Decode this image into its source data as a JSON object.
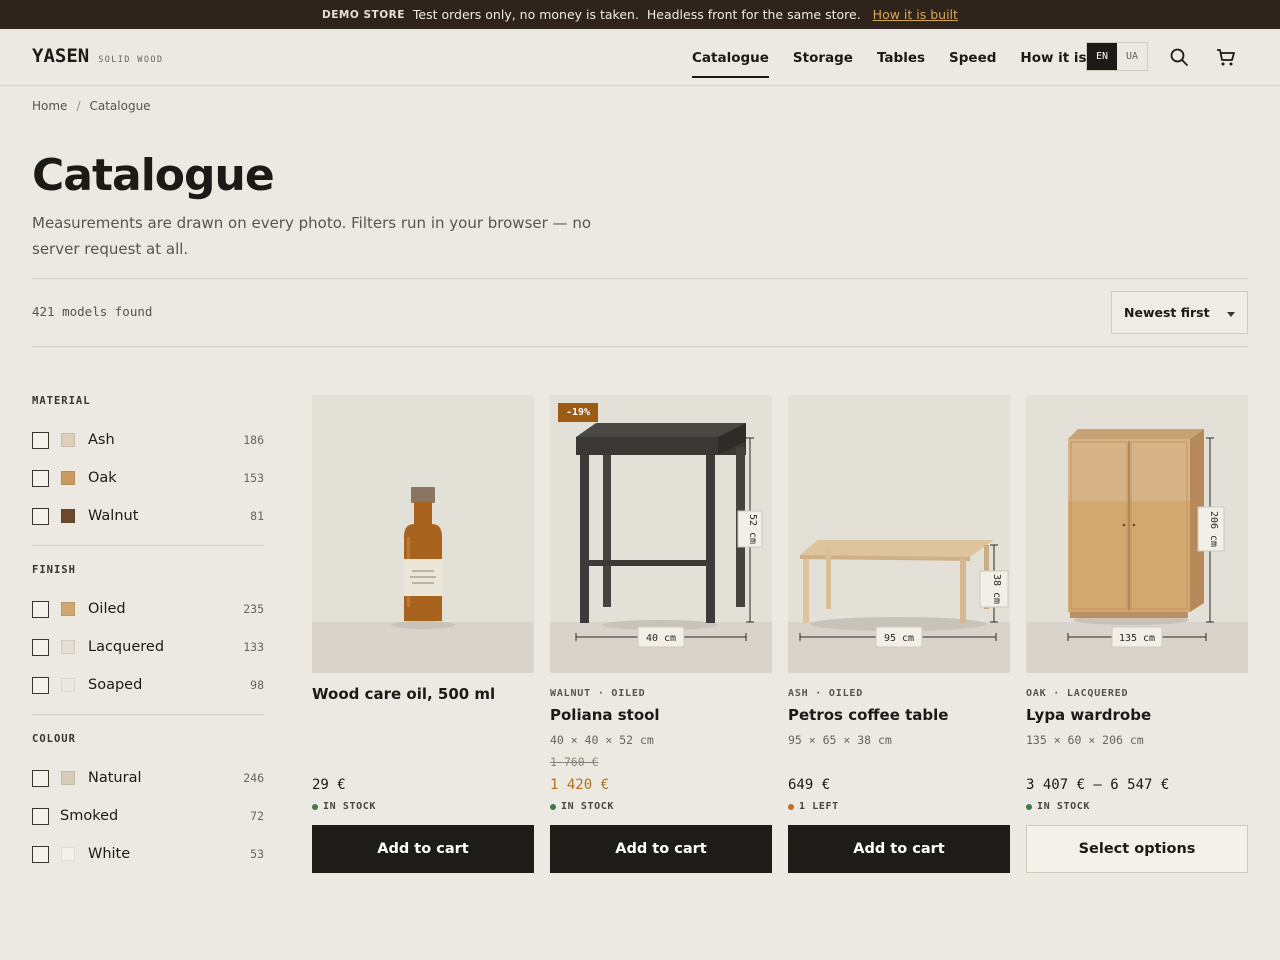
{
  "banner": {
    "tag": "DEMO STORE",
    "text": "Test orders only, no money is taken.  Headless front for the same store.",
    "link": "How it is built"
  },
  "header": {
    "brand": "YASEN",
    "tagline": "SOLID WOOD",
    "nav": [
      "Catalogue",
      "Storage",
      "Tables",
      "Speed",
      "How it is built"
    ],
    "active_nav": "Catalogue",
    "lang": [
      "EN",
      "UA"
    ],
    "active_lang": "EN",
    "icons": [
      "search-icon",
      "cart-icon"
    ]
  },
  "breadcrumb": [
    "Home",
    "Catalogue"
  ],
  "page": {
    "title": "Catalogue",
    "lede": "Measurements are drawn on every photo. Filters run in your browser — no server request at all.",
    "count": "421 models found",
    "sort": "Newest first"
  },
  "filters": [
    {
      "title": "MATERIAL",
      "options": [
        {
          "label": "Ash",
          "count": "186",
          "swatch": "#dcd0bb"
        },
        {
          "label": "Oak",
          "count": "153",
          "swatch": "#c9995e"
        },
        {
          "label": "Walnut",
          "count": "81",
          "swatch": "#6b4a2e"
        }
      ]
    },
    {
      "title": "FINISH",
      "options": [
        {
          "label": "Oiled",
          "count": "235",
          "swatch": "#cfa772"
        },
        {
          "label": "Lacquered",
          "count": "133",
          "swatch": "#e3dfd6"
        },
        {
          "label": "Soaped",
          "count": "98",
          "swatch": "#ece8e0"
        }
      ]
    },
    {
      "title": "COLOUR",
      "options": [
        {
          "label": "Natural",
          "count": "246",
          "swatch": "#d8ccb6"
        },
        {
          "label": "Smoked",
          "count": "72",
          "swatch": ""
        },
        {
          "label": "White",
          "count": "53",
          "swatch": "#f3f1ec"
        }
      ]
    }
  ],
  "products": [
    {
      "meta": "",
      "name": "Wood care oil, 500 ml",
      "dims": "",
      "old_price": "",
      "price": "29 €",
      "sale": false,
      "stock": "IN STOCK",
      "stock_color": "#3f7a4a",
      "button": "Add to cart",
      "badge": "",
      "dim_labels": []
    },
    {
      "meta": "WALNUT · OILED",
      "name": "Poliana stool",
      "dims": "40 × 40 × 52 cm",
      "old_price": "1 760 €",
      "price": "1 420 €",
      "sale": true,
      "stock": "IN STOCK",
      "stock_color": "#3f7a4a",
      "button": "Add to cart",
      "badge": "-19%",
      "dim_labels": [
        "40 cm",
        "52 cm"
      ]
    },
    {
      "meta": "ASH · OILED",
      "name": "Petros coffee table",
      "dims": "95 × 65 × 38 cm",
      "old_price": "",
      "price": "649 €",
      "sale": false,
      "stock": "1 LEFT",
      "stock_color": "#c66a1e",
      "button": "Add to cart",
      "badge": "",
      "dim_labels": [
        "95 cm",
        "38 cm"
      ]
    },
    {
      "meta": "OAK · LACQUERED",
      "name": "Lypa wardrobe",
      "dims": "135 × 60 × 206 cm",
      "old_price": "",
      "price": "3 407 € – 6 547 €",
      "sale": false,
      "stock": "IN STOCK",
      "stock_color": "#3f7a4a",
      "button": "Select options",
      "badge": "",
      "dim_labels": [
        "135 cm",
        "206 cm"
      ]
    }
  ]
}
